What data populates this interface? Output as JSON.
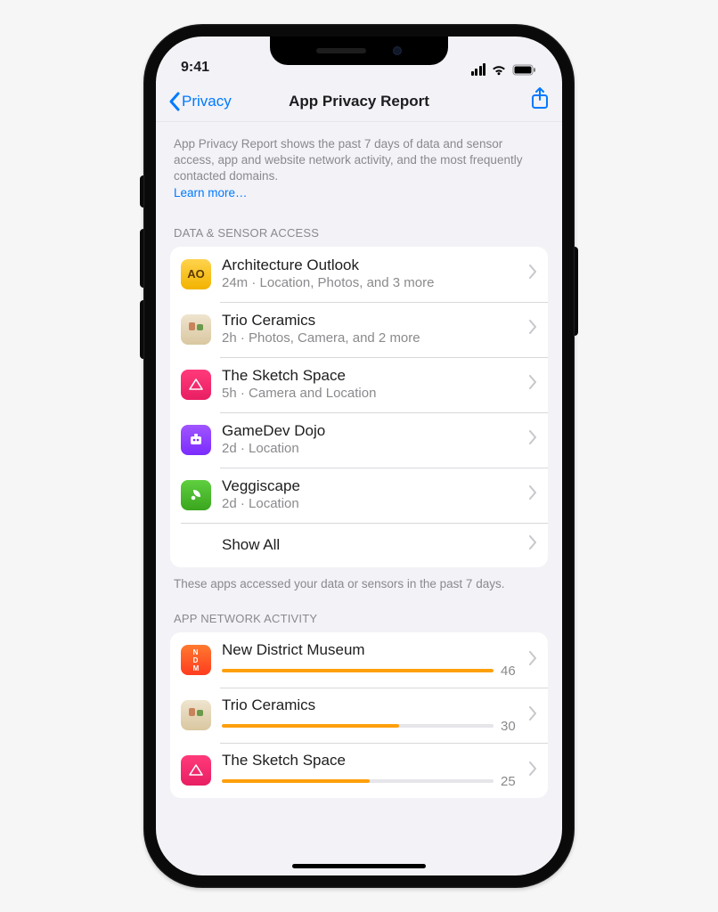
{
  "status": {
    "time": "9:41"
  },
  "nav": {
    "back_label": "Privacy",
    "title": "App Privacy Report"
  },
  "intro": {
    "text": "App Privacy Report shows the past 7 days of data and sensor access, app and website network activity, and the most frequently contacted domains.",
    "learn_more": "Learn more…"
  },
  "sections": {
    "data_access": {
      "header": "DATA & SENSOR ACCESS",
      "footer": "These apps accessed your data or sensors in the past 7 days.",
      "show_all": "Show All",
      "items": [
        {
          "name": "Architecture Outlook",
          "sub": "24m · Location, Photos, and 3 more",
          "icon_class": "ic-yellow",
          "icon_text": "AO"
        },
        {
          "name": "Trio Ceramics",
          "sub": "2h · Photos, Camera, and 2 more",
          "icon_class": "ic-beige",
          "icon_text": ""
        },
        {
          "name": "The Sketch Space",
          "sub": "5h · Camera and Location",
          "icon_class": "ic-pink",
          "icon_text": ""
        },
        {
          "name": "GameDev Dojo",
          "sub": "2d · Location",
          "icon_class": "ic-purple",
          "icon_text": ""
        },
        {
          "name": "Veggiscape",
          "sub": "2d · Location",
          "icon_class": "ic-green",
          "icon_text": ""
        }
      ]
    },
    "network": {
      "header": "APP NETWORK ACTIVITY",
      "max": 46,
      "items": [
        {
          "name": "New District Museum",
          "value": 46,
          "icon_class": "ic-orange",
          "icon_text": ""
        },
        {
          "name": "Trio Ceramics",
          "value": 30,
          "icon_class": "ic-beige",
          "icon_text": ""
        },
        {
          "name": "The Sketch Space",
          "value": 25,
          "icon_class": "ic-pink",
          "icon_text": ""
        }
      ]
    }
  }
}
